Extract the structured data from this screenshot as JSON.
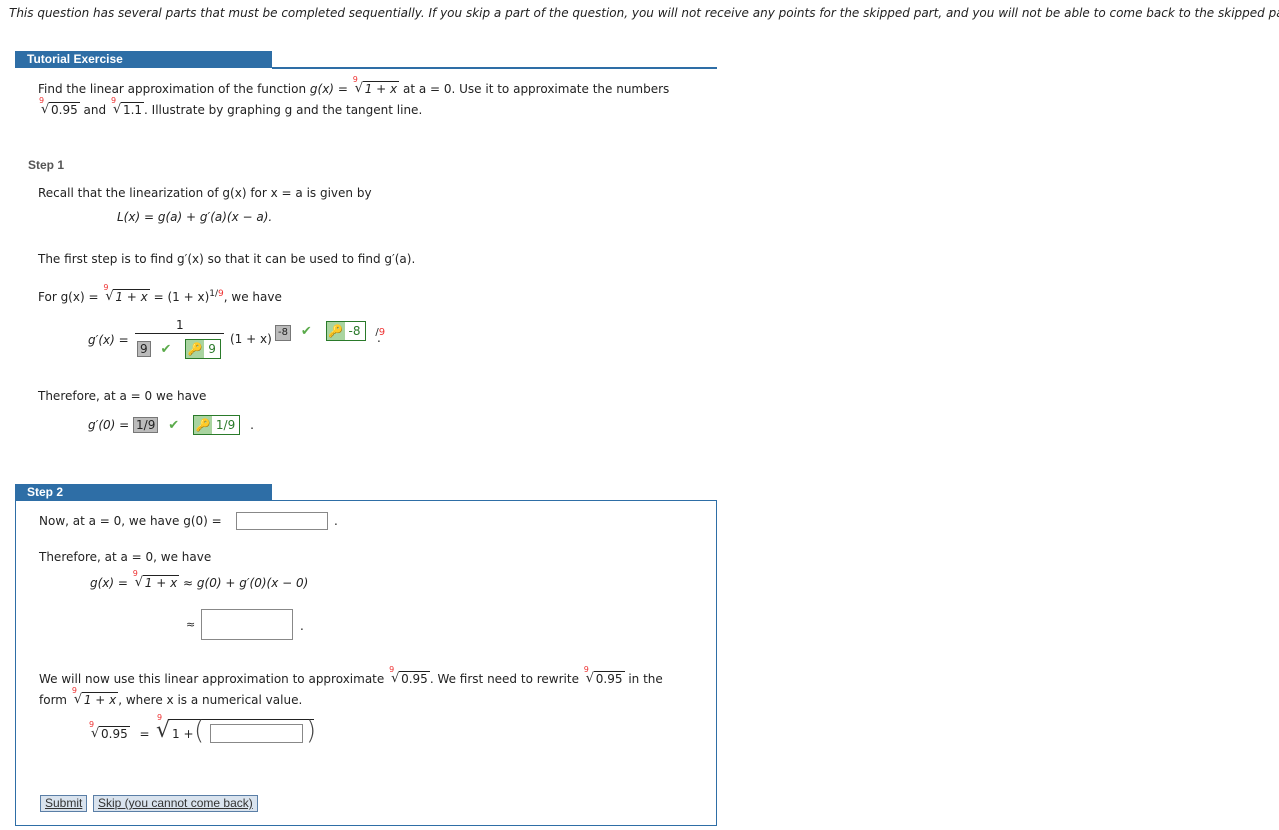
{
  "notice": "This question has several parts that must be completed sequentially. If you skip a part of the question, you will not receive any points for the skipped part, and you will not be able to come back to the skipped part.",
  "tutorial": {
    "header": "Tutorial Exercise",
    "problem_line1_pre": "Find the linear approximation of the function ",
    "g_of_x": "g(x)",
    "equals": "=",
    "root_index": "9",
    "radicand_1px": "1 + x",
    "problem_line1_post": "at a = 0. Use it to approximate the numbers",
    "radicand_095": "0.95",
    "and": "and",
    "radicand_11": "1.1",
    "problem_line2_post": ". Illustrate by graphing g and the tangent line."
  },
  "step1": {
    "label": "Step 1",
    "recall": "Recall that the linearization of  g(x)  for x = a is given by",
    "linearization": "L(x) = g(a) + g′(a)(x − a).",
    "first_step": "The first step is to find  g′(x)  so that it can be used to find  g′(a).",
    "for_pre": "For  g(x) =",
    "for_mid": "= (1 + x)",
    "exp_num": "1/",
    "exp_den": "9",
    "for_post": ",  we have",
    "gprime_label": "g′(x) =",
    "numerator": "1",
    "denominator_answer": "9",
    "denominator_correct": "9",
    "base": "(1 + x)",
    "exponent_answer": "-8",
    "exponent_correct": "-8",
    "exponent_suffix_slash": "/",
    "exponent_suffix_den": "9",
    "therefore": "Therefore, at  a = 0  we have",
    "gprime0_label": "g′(0) =",
    "gprime0_answer": "1/9",
    "gprime0_correct": "1/9"
  },
  "step2": {
    "label": "Step 2",
    "now_line": "Now, at  a = 0,  we have  g(0) =",
    "g0_value": "",
    "therefore": "Therefore, at  a = 0,  we have",
    "approx_pre": "g(x) =",
    "approx_post": "≈  g(0) + g′(0)(x − 0)",
    "approx_symbol": "≈",
    "linear_value": "",
    "rewrite_pre": "We will now use this linear approximation to approximate",
    "rewrite_mid": ". We first need to rewrite",
    "rewrite_post": "in the",
    "form_pre": "form",
    "form_post": ",  where x is a numerical value.",
    "radicand_095": "0.95",
    "one_plus": "1 +",
    "x_value": "",
    "submit": "Submit",
    "skip": "Skip (you cannot come back)"
  },
  "colors": {
    "header_bg": "#2e6ea6",
    "correct_green": "#2a7a2a",
    "check_green": "#5aaa4a",
    "root_index_red": "#e33333"
  }
}
